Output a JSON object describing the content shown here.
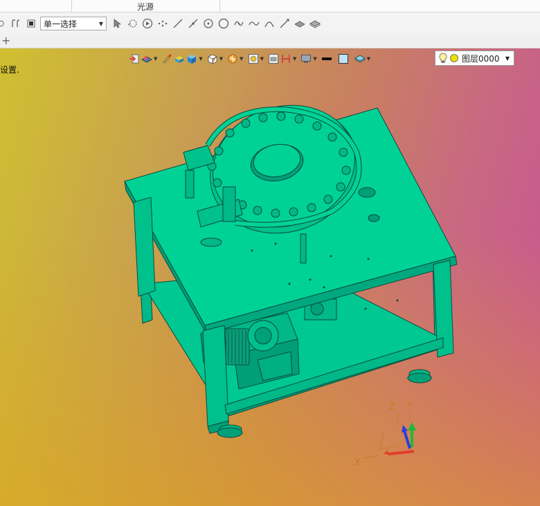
{
  "ribbon": {
    "group_label": "光源"
  },
  "selection_toolbar": {
    "filter_value": "单一选择",
    "icons": [
      "rotate-icon",
      "undo-redo-icon",
      "stop-icon"
    ],
    "tool_icons": [
      "cursor-pick-icon",
      "smart-pick-icon",
      "play-icon",
      "point-cloud-icon",
      "line-icon",
      "edge-icon",
      "center-point-icon",
      "circle-icon",
      "spline-icon",
      "curve-icon",
      "arc-icon",
      "axis-icon",
      "surface-icon",
      "solid-icon"
    ]
  },
  "tabs": {
    "add_label": "+"
  },
  "viewport": {
    "status_hint": "设置."
  },
  "view_toolbar": {
    "icons": [
      "exit-icon",
      "render-mode-icon",
      "paint-icon",
      "material-icon",
      "shaded-cube-icon",
      "wire-cube-icon",
      "light-icon",
      "view-orient-icon",
      "section-icon",
      "dimension-icon",
      "display-icon",
      "line-color-icon",
      "fill-color-icon",
      "layer-icon"
    ],
    "layer_value": "图层0000"
  },
  "axes": {
    "x_label": "X",
    "y_label": "Y",
    "z_label": "Z"
  },
  "colors": {
    "model": "#00d296",
    "model_edge": "#0b4a3a",
    "axis_x": "#e33c2c",
    "axis_y": "#1fb83a",
    "axis_z": "#2a3fd6"
  }
}
